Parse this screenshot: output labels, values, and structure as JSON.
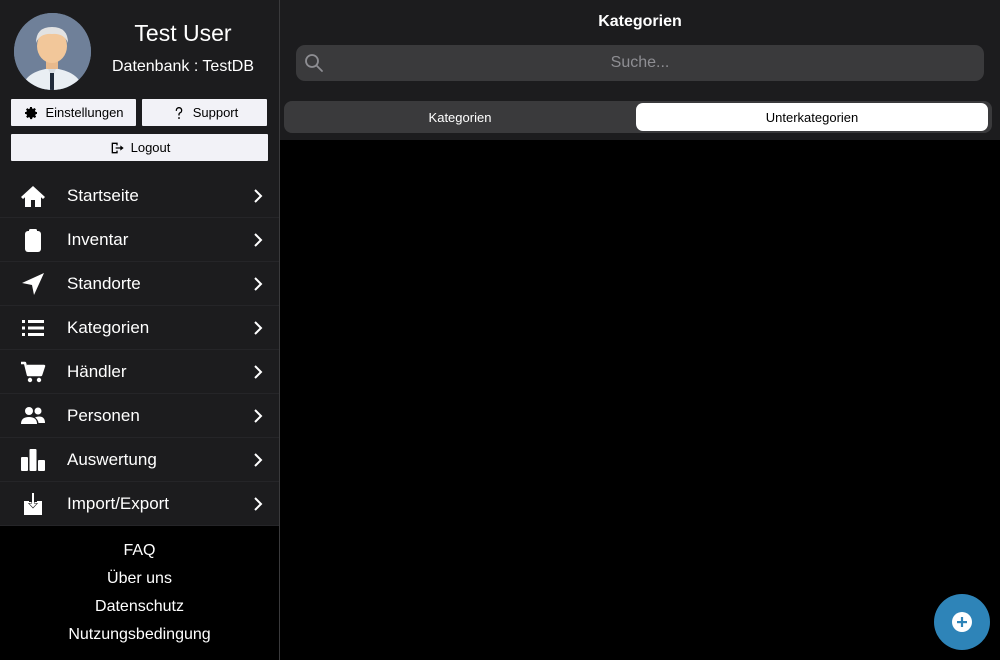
{
  "user": {
    "name": "Test User",
    "database_line": "Datenbank : TestDB"
  },
  "buttons": {
    "settings": "Einstellungen",
    "support": "Support",
    "logout": "Logout"
  },
  "nav": {
    "items": [
      {
        "label": "Startseite",
        "icon": "home-icon"
      },
      {
        "label": "Inventar",
        "icon": "clipboard-icon"
      },
      {
        "label": "Standorte",
        "icon": "location-arrow-icon"
      },
      {
        "label": "Kategorien",
        "icon": "list-icon"
      },
      {
        "label": "Händler",
        "icon": "cart-icon"
      },
      {
        "label": "Personen",
        "icon": "people-icon"
      },
      {
        "label": "Auswertung",
        "icon": "chart-icon"
      },
      {
        "label": "Import/Export",
        "icon": "download-icon"
      }
    ]
  },
  "footer": {
    "links": [
      "FAQ",
      "Über uns",
      "Datenschutz",
      "Nutzungsbedingung"
    ]
  },
  "main": {
    "title": "Kategorien",
    "search_placeholder": "Suche...",
    "segments": [
      "Kategorien",
      "Unterkategorien"
    ],
    "selected_segment": "Unterkategorien"
  },
  "colors": {
    "sidebar_bg": "#1c1c1e",
    "fab": "#2e84b8",
    "segment_selected": "#ffffff"
  }
}
